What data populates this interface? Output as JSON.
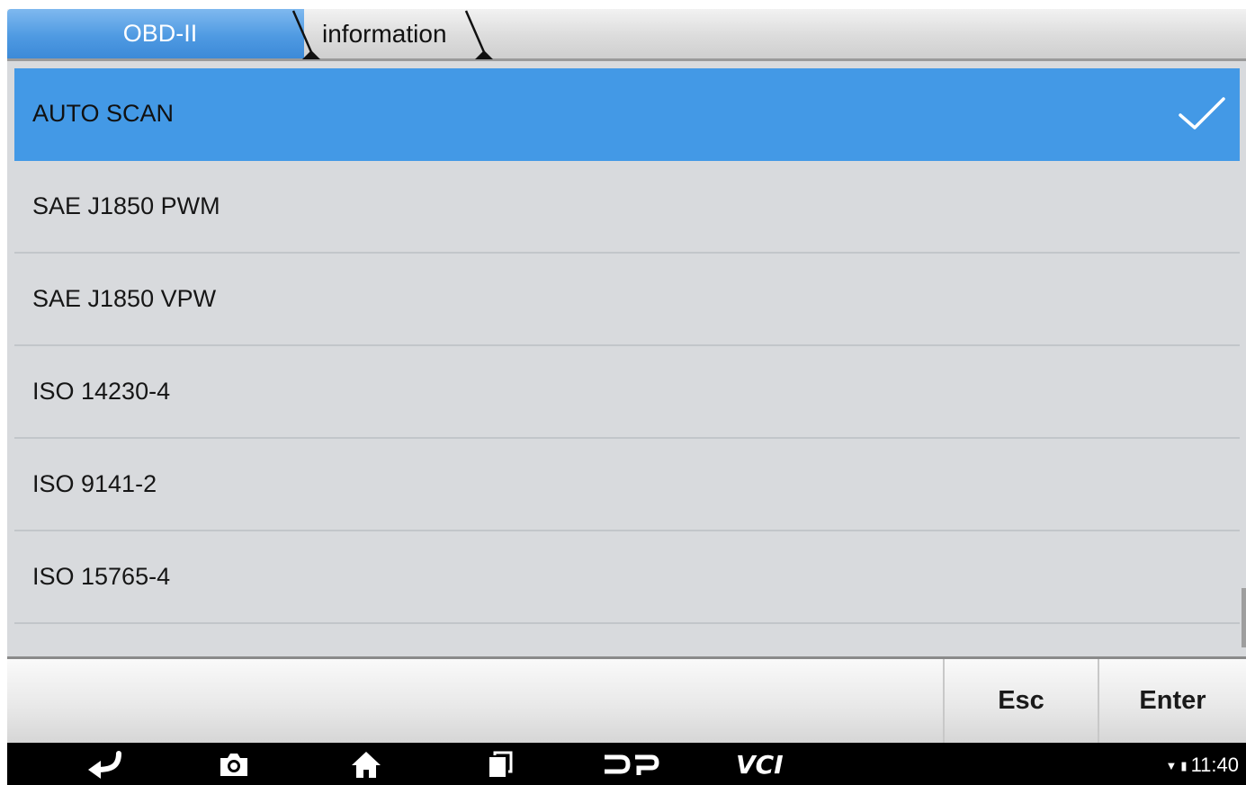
{
  "breadcrumb": {
    "items": [
      "OBD-II",
      "information"
    ]
  },
  "list": {
    "items": [
      {
        "label": "AUTO SCAN",
        "selected": true
      },
      {
        "label": "SAE J1850 PWM",
        "selected": false
      },
      {
        "label": "SAE J1850 VPW",
        "selected": false
      },
      {
        "label": "ISO 14230-4",
        "selected": false
      },
      {
        "label": "ISO 9141-2",
        "selected": false
      },
      {
        "label": "ISO 15765-4",
        "selected": false
      }
    ],
    "selected_icon": "check-icon"
  },
  "actions": {
    "esc_label": "Esc",
    "enter_label": "Enter"
  },
  "navbar": {
    "icons": [
      "back-icon",
      "camera-icon",
      "home-icon",
      "recent-apps-icon",
      "dp-logo-icon",
      "vci-icon"
    ],
    "vci_label": "VCI",
    "time": "11:40"
  },
  "colors": {
    "accent": "#4399e6",
    "list_bg": "#d8dadd"
  }
}
